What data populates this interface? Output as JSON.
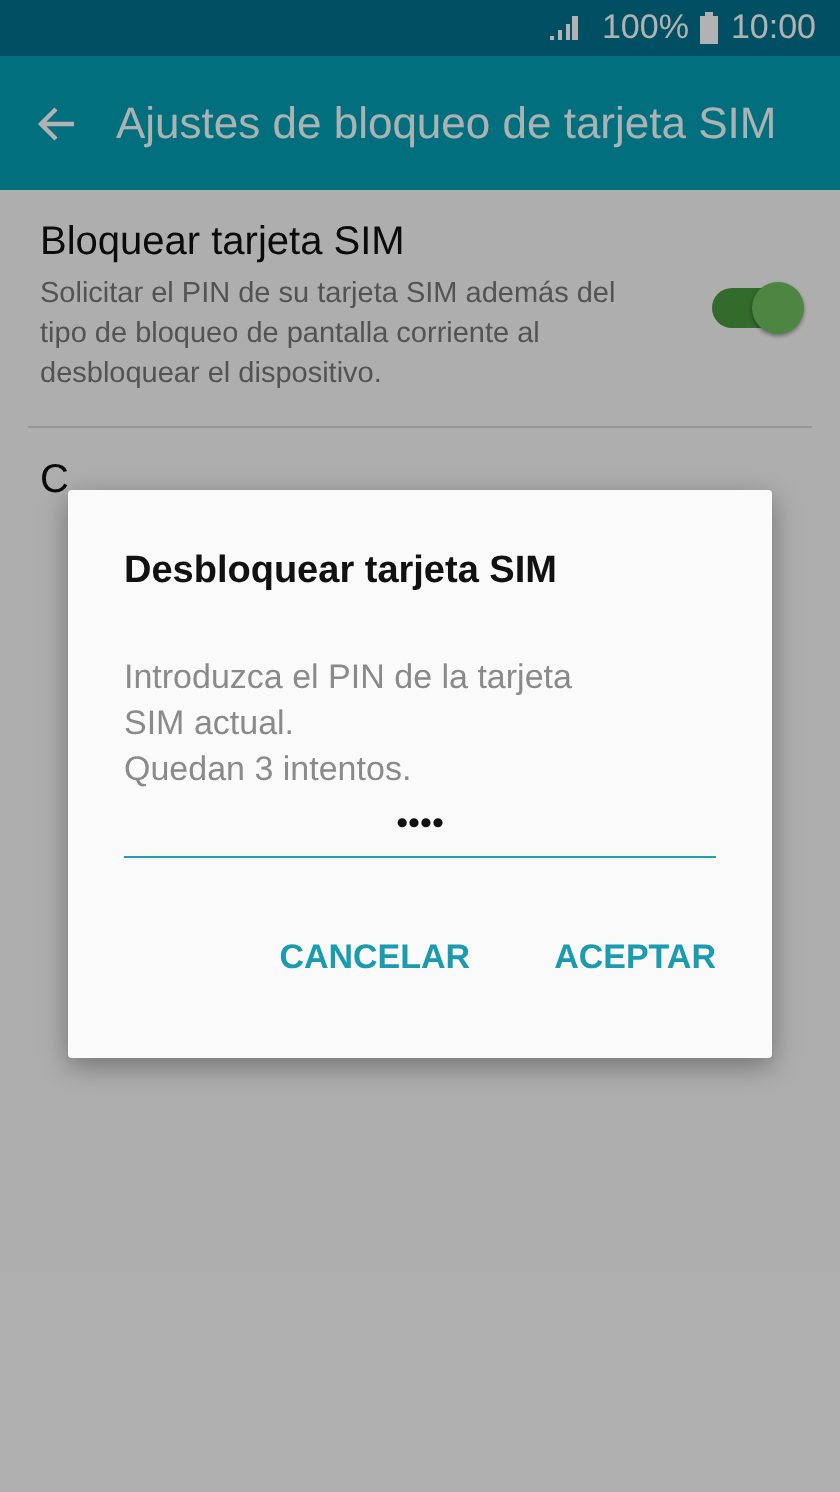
{
  "status_bar": {
    "battery": "100%",
    "time": "10:00"
  },
  "app_bar": {
    "title": "Ajustes de bloqueo de tarjeta SIM"
  },
  "settings": [
    {
      "kind": "toggle",
      "title": "Bloquear tarjeta SIM",
      "summary": "Solicitar el PIN de su tarjeta SIM además del tipo de bloqueo de pantalla corriente al desbloquear el dispositivo.",
      "on": true
    },
    {
      "kind": "plain",
      "title": "C"
    }
  ],
  "dialog": {
    "title": "Desbloquear tarjeta SIM",
    "message": [
      "Introduzca el PIN de la tarjeta",
      "SIM actual.",
      "Quedan 3 intentos."
    ],
    "pin_value": "••••",
    "buttons": [
      "CANCELAR",
      "ACEPTAR"
    ]
  }
}
